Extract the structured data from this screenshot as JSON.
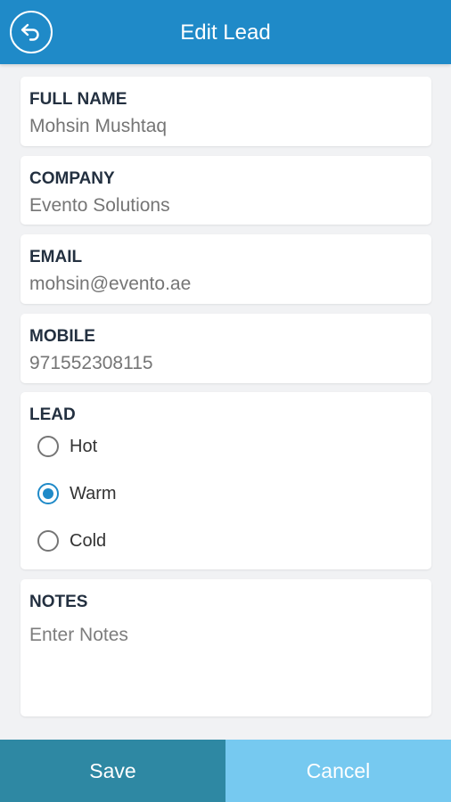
{
  "header": {
    "title": "Edit Lead",
    "back_icon": "back-arrow-circle-icon"
  },
  "form": {
    "full_name": {
      "label": "FULL NAME",
      "value": "Mohsin Mushtaq"
    },
    "company": {
      "label": "COMPANY",
      "value": "Evento Solutions"
    },
    "email": {
      "label": "EMAIL",
      "value": "mohsin@evento.ae"
    },
    "mobile": {
      "label": "MOBILE",
      "value": "971552308115"
    },
    "lead": {
      "label": "LEAD",
      "options": [
        {
          "label": "Hot",
          "selected": false
        },
        {
          "label": "Warm",
          "selected": true
        },
        {
          "label": "Cold",
          "selected": false
        }
      ]
    },
    "notes": {
      "label": "NOTES",
      "placeholder": "Enter Notes",
      "value": ""
    }
  },
  "footer": {
    "save_label": "Save",
    "cancel_label": "Cancel"
  },
  "colors": {
    "primary": "#1f8ac8",
    "save": "#2e88a3",
    "cancel": "#76c9f0",
    "background": "#f1f2f4"
  }
}
